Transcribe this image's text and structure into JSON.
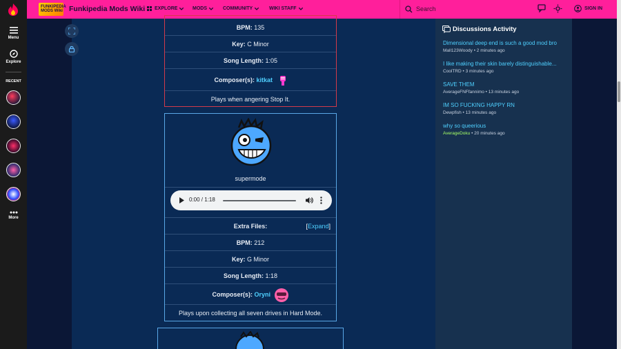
{
  "rail": {
    "menu_label": "Menu",
    "explore_label": "Explore",
    "recent_label": "RECENT",
    "more_label": "More"
  },
  "topbar": {
    "wiki_logo_text": "FUNKIPEDIA MODS Wiki",
    "wiki_name": "Funkipedia Mods Wiki",
    "nav": [
      "EXPLORE",
      "MODS",
      "COMMUNITY",
      "WIKI STAFF"
    ],
    "search_placeholder": "Search",
    "signin_label": "SIGN IN"
  },
  "song1": {
    "bpm_label": "BPM:",
    "bpm": "135",
    "key_label": "Key:",
    "key": "C Minor",
    "length_label": "Song Length:",
    "length": "1:05",
    "composer_label": "Composer(s):",
    "composer": "kitkat",
    "note": "Plays when angering Stop It."
  },
  "song2": {
    "title": "supermode",
    "audio_time": "0:00 / 1:18",
    "extra_label": "Extra Files:",
    "expand_label": "Expand",
    "bpm_label": "BPM:",
    "bpm": "212",
    "key_label": "Key:",
    "key": "G Minor",
    "length_label": "Song Length:",
    "length": "1:18",
    "composer_label": "Composer(s):",
    "composer": "Oryni",
    "note": "Plays upon collecting all seven drives in Hard Mode."
  },
  "discussions": {
    "title": "Discussions Activity",
    "items": [
      {
        "title": "Dimensional deep end is such a good mod bro",
        "user": "Mall123Woody",
        "time": "2 minutes ago"
      },
      {
        "title": "I like making their skin barely distinguishable...",
        "user": "CoolTRD",
        "time": "3 minutes ago"
      },
      {
        "title": "SAVE THEM",
        "user": "AverageFNFfannimo",
        "time": "13 minutes ago"
      },
      {
        "title": "IM SO FUCKING HAPPY RN",
        "user": "Dewpfish",
        "time": "13 minutes ago"
      },
      {
        "title": "why so queerious",
        "user": "AverageDoku",
        "time": "20 minutes ago"
      }
    ]
  },
  "colors": {
    "topbar": "#ff1f9b",
    "accent_link": "#4fd0ff",
    "red_border": "#d43a4a",
    "blue_border": "#5aa8e8"
  }
}
